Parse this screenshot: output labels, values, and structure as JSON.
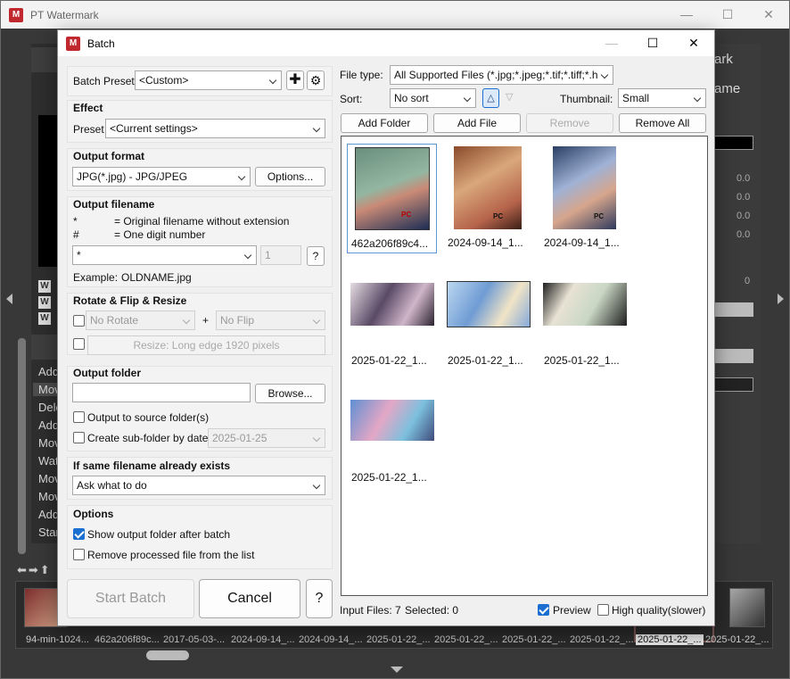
{
  "app": {
    "title": "PT Watermark",
    "right_panel_title": "ark",
    "right_panel_title2": "ame",
    "values": [
      "0.0",
      "0.0",
      "0.0",
      "0.0",
      "0"
    ],
    "history_items": [
      "Add",
      "Mov",
      "Dele",
      "Add",
      "Mov",
      "Wat",
      "Mov",
      "Mov",
      "Add",
      "Star"
    ],
    "filmstrip_labels": [
      "94-min-1024...",
      "462a206f89c...",
      "2017-05-03-...",
      "2024-09-14_...",
      "2024-09-14_...",
      "2025-01-22_...",
      "2025-01-22_...",
      "2025-01-22_...",
      "2025-01-22_...",
      "2025-01-22_...",
      "2025-01-22_..."
    ],
    "filmstrip_selected_index": 8
  },
  "dialog": {
    "title": "Batch",
    "batch_preset": {
      "label": "Batch Preset",
      "value": "<Custom>"
    },
    "effect": {
      "title": "Effect",
      "preset_label": "Preset",
      "preset_value": "<Current settings>"
    },
    "output_format": {
      "title": "Output format",
      "value": "JPG(*.jpg) - JPG/JPEG",
      "options_button": "Options..."
    },
    "output_filename": {
      "title": "Output filename",
      "legend": [
        {
          "key": "*",
          "desc": "= Original filename without extension"
        },
        {
          "key": "#",
          "desc": "= One digit number"
        }
      ],
      "pattern_value": "*",
      "digits_value": "1",
      "help_button": "?",
      "example_label": "Example:",
      "example_value": "OLDNAME.jpg"
    },
    "rotate": {
      "title": "Rotate & Flip & Resize",
      "rotate_value": "No Rotate",
      "plus": "+",
      "flip_value": "No Flip",
      "resize_label": "Resize: Long edge 1920 pixels"
    },
    "output_folder": {
      "title": "Output folder",
      "path_value": "",
      "browse_button": "Browse...",
      "to_source_label": "Output to source folder(s)",
      "subfolder_label": "Create sub-folder by date",
      "subfolder_date": "2025-01-25"
    },
    "same_filename": {
      "title": "If same filename already exists",
      "value": "Ask what to do"
    },
    "options": {
      "title": "Options",
      "show_folder_label": "Show output folder after batch",
      "remove_processed_label": "Remove processed file from the list"
    },
    "start_button": "Start Batch",
    "cancel_button": "Cancel",
    "help_button": "?",
    "file_type": {
      "label": "File type:",
      "value": "All Supported Files (*.jpg;*.jpeg;*.tif;*.tiff;*.h"
    },
    "sort": {
      "label": "Sort:",
      "value": "No sort",
      "asc_glyph": "△",
      "desc_glyph": "▽"
    },
    "thumbnail": {
      "label": "Thumbnail:",
      "value": "Small"
    },
    "actions": {
      "add_folder": "Add Folder",
      "add_file": "Add File",
      "remove": "Remove",
      "remove_all": "Remove All"
    },
    "files": [
      "462a206f89c4...",
      "2024-09-14_1...",
      "2024-09-14_1...",
      "2025-01-22_1...",
      "2025-01-22_1...",
      "2025-01-22_1...",
      "2025-01-22_1..."
    ],
    "status": {
      "input_files": "Input Files: 7",
      "selected": "Selected: 0"
    },
    "preview_label": "Preview",
    "high_quality_label": "High quality(slower)",
    "watermark_text": "PC"
  }
}
